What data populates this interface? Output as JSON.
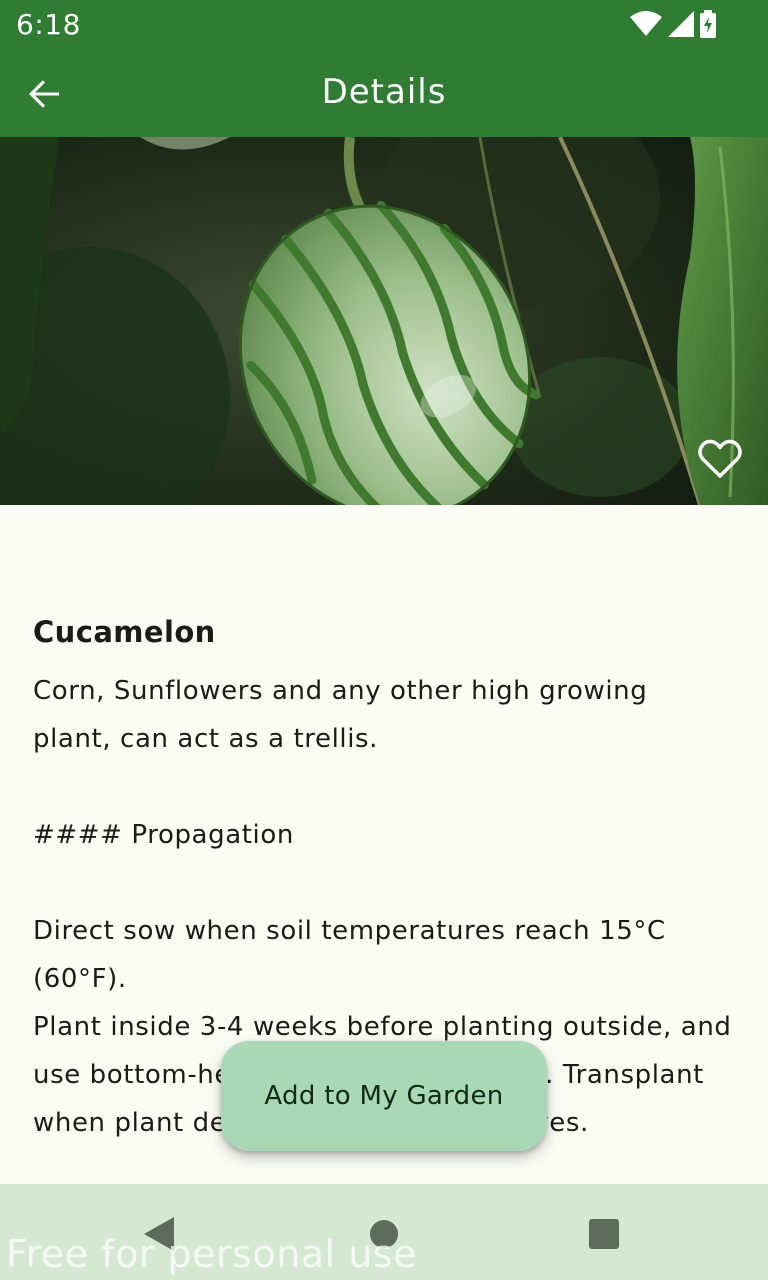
{
  "status_bar": {
    "time": "6:18",
    "icons": [
      "wifi-icon",
      "cell-signal-icon",
      "battery-charging-icon"
    ]
  },
  "app_bar": {
    "title": "Details",
    "back_icon": "arrow-back-icon",
    "background": "#2e7d32"
  },
  "hero": {
    "favorite_icon": "heart-outline-icon"
  },
  "plant": {
    "name": "Cucamelon",
    "description": "Corn, Sunflowers and any other high growing plant, can act as a trellis.\n\n#### Propagation\n\nDirect sow when soil temperatures reach 15°C (60°F).\nPlant inside 3-4 weeks before planting outside, and use bottom-heat for best germination. Transplant when plant develops its first true leaves."
  },
  "fab": {
    "label": "Add to My Garden",
    "background": "#a8d9b4"
  },
  "nav_bar": {
    "icons": [
      "nav-back-icon",
      "nav-home-icon",
      "nav-recents-icon"
    ]
  },
  "watermark": "Free for personal use"
}
